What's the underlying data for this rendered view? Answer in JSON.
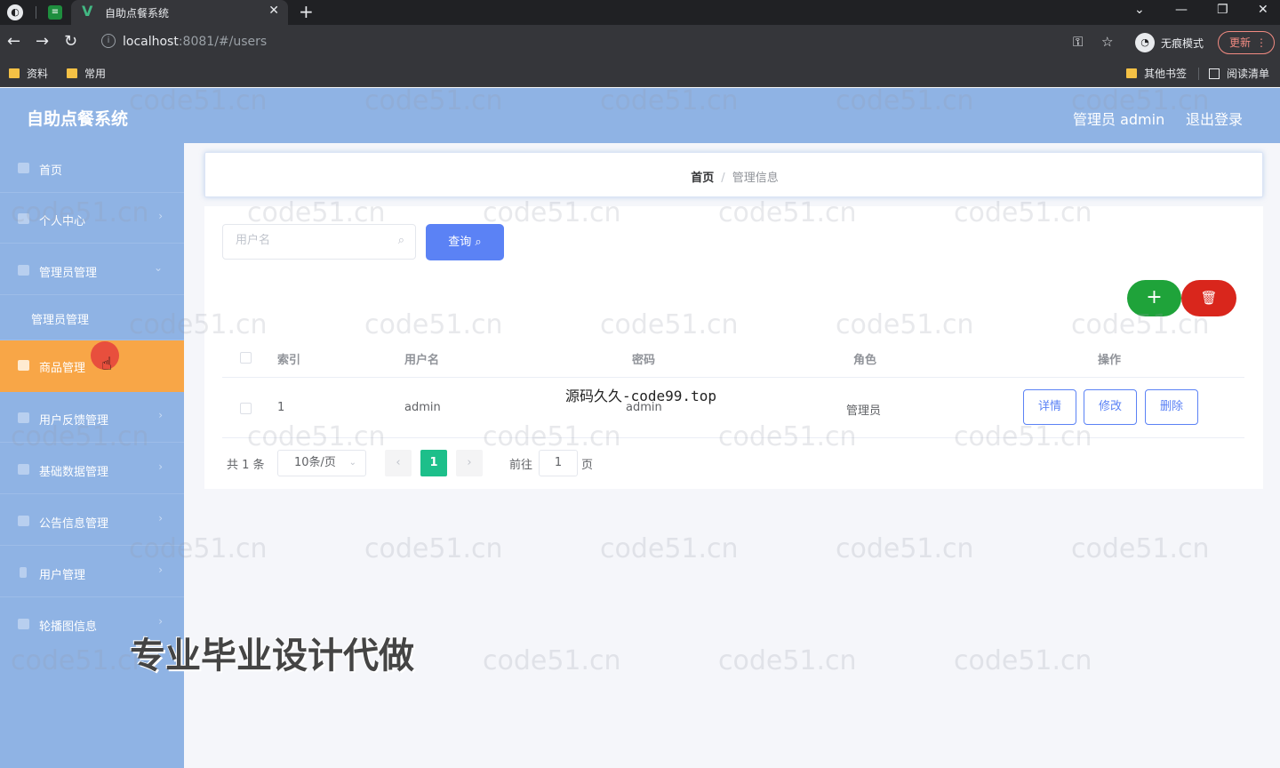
{
  "browser": {
    "tab_title": "自助点餐系统",
    "url_host": "localhost",
    "url_path": ":8081/#/users",
    "incognito_label": "无痕模式",
    "update_label": "更新",
    "bookmarks": [
      "资料",
      "常用"
    ],
    "bookmarks_right": [
      "其他书签",
      "阅读清单"
    ]
  },
  "header": {
    "title": "自助点餐系统",
    "admin_label": "管理员 admin",
    "logout_label": "退出登录"
  },
  "sidebar": {
    "items": [
      {
        "label": "首页"
      },
      {
        "label": "个人中心"
      },
      {
        "label": "管理员管理"
      },
      {
        "label": "管理员管理"
      },
      {
        "label": "商品管理"
      },
      {
        "label": "用户反馈管理"
      },
      {
        "label": "基础数据管理"
      },
      {
        "label": "公告信息管理"
      },
      {
        "label": "用户管理"
      },
      {
        "label": "轮播图信息"
      }
    ],
    "active_index": 4
  },
  "breadcrumb": {
    "home": "首页",
    "separator": "/",
    "current": "管理信息"
  },
  "search": {
    "placeholder": "用户名",
    "value": "",
    "button_label": "查询"
  },
  "actions": {
    "add_symbol": "+"
  },
  "table": {
    "headers": [
      "索引",
      "用户名",
      "密码",
      "角色",
      "操作"
    ],
    "rows": [
      {
        "index": "1",
        "username": "admin",
        "password": "admin",
        "role": "管理员"
      }
    ],
    "row_buttons": [
      "详情",
      "修改",
      "删除"
    ]
  },
  "pagination": {
    "total_label": "共 1 条",
    "page_size": "10条/页",
    "current_page": "1",
    "goto_label": "前往",
    "goto_value": "1",
    "page_suffix": "页"
  },
  "overlays": {
    "source_text": "源码久久-code99.top",
    "banner_text": "专业毕业设计代做",
    "watermark": "code51.cn"
  },
  "colors": {
    "header_bg": "#8fb3e4",
    "active_menu": "#f8a647",
    "primary": "#5b82f5",
    "add": "#1fa33a",
    "delete": "#d9261c",
    "current_page": "#1dbf8a"
  }
}
